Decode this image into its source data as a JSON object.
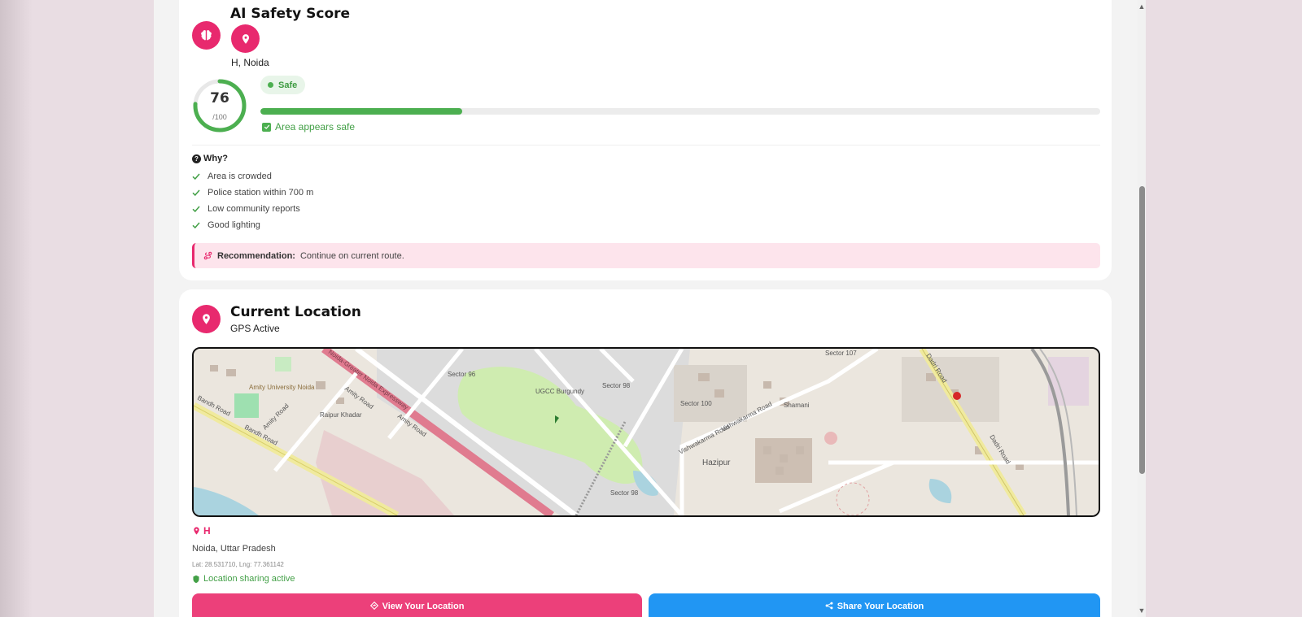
{
  "safety": {
    "title": "AI Safety Score",
    "place": "H, Noida",
    "score": "76",
    "score_max": "/100",
    "score_fraction": 0.24,
    "status_badge": "Safe",
    "status_text": "Area appears safe",
    "why_label": "Why?",
    "reasons": [
      "Area is crowded",
      "Police station within 700 m",
      "Low community reports",
      "Good lighting"
    ],
    "recommendation_label": "Recommendation:",
    "recommendation_text": "Continue on current route."
  },
  "location": {
    "title": "Current Location",
    "subtitle": "GPS Active",
    "place_name": "H",
    "address": "Noida, Uttar Pradesh",
    "coords": "Lat: 28.531710, Lng: 77.361142",
    "sharing_status": "Location sharing active",
    "view_button": "View Your Location",
    "share_button": "Share Your Location"
  },
  "map": {
    "labels": {
      "sector96": "Sector 96",
      "sector98": "Sector 98",
      "sector100": "Sector 100",
      "sector107": "Sector 107",
      "sector98b": "Sector 98",
      "amity": "Amity University Noida",
      "raipur": "Raipur Khadar",
      "bandh1": "Bandh Road",
      "bandh2": "Bandh Road",
      "amityroad": "Amity Road",
      "amityroad2": "Amity Road",
      "amityroad3": "Amity Road",
      "expressway": "Noida-Greater Noida Expressway",
      "ugcc": "UGCC Burgundy",
      "vishwakarma": "Vishwakarma Road",
      "vishwakarma2": "Vishwakarma Road",
      "shamani": "Shamani",
      "hazipur": "Hazipur",
      "dadri": "Dadri Road",
      "dadri2": "Dadri Road"
    }
  },
  "colors": {
    "brand_pink": "#e8296e",
    "safe_green": "#4caf50",
    "share_blue": "#2196f3"
  },
  "icons": {
    "safety_header": "brain-icon",
    "location_badge": "map-pin-icon",
    "why": "question-circle-icon",
    "reason": "check-icon",
    "recommendation": "route-icon",
    "sharing": "shield-icon",
    "view": "diamond-direction-icon",
    "share": "share-icon"
  }
}
